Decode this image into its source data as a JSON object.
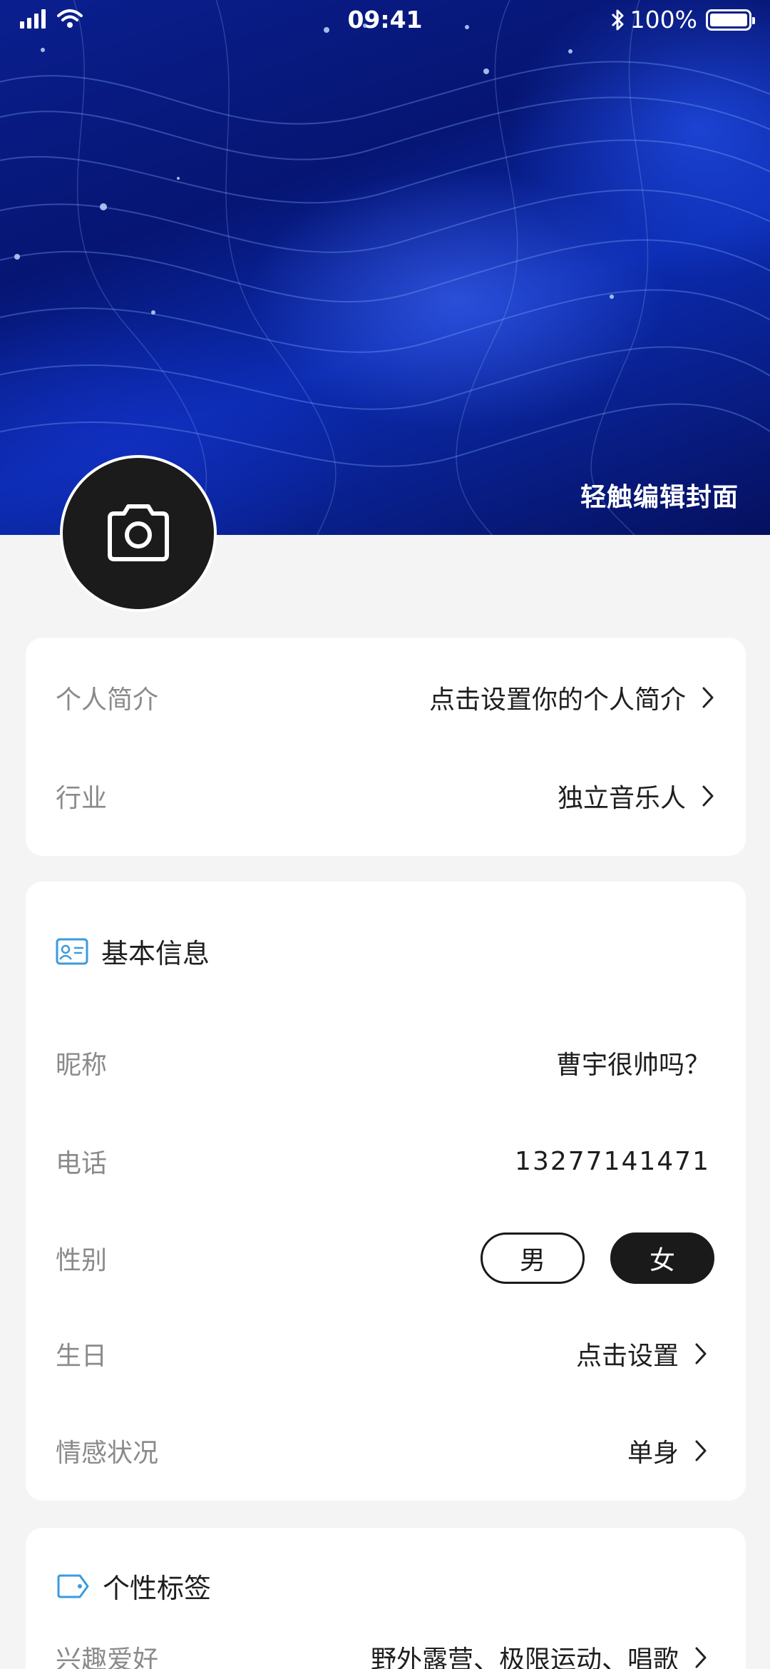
{
  "status_bar": {
    "time": "09:41",
    "battery": "100%"
  },
  "cover": {
    "edit_label": "轻触编辑封面"
  },
  "profile_card": {
    "rows": [
      {
        "label": "个人简介",
        "value": "点击设置你的个人简介"
      },
      {
        "label": "行业",
        "value": "独立音乐人"
      }
    ]
  },
  "basic_info": {
    "title": "基本信息",
    "nickname": {
      "label": "昵称",
      "value": "曹宇很帅吗？"
    },
    "phone": {
      "label": "电话",
      "value": "13277141471"
    },
    "gender": {
      "label": "性别",
      "options": [
        "男",
        "女"
      ],
      "selected": "女"
    },
    "birthday": {
      "label": "生日",
      "value": "点击设置"
    },
    "relationship": {
      "label": "情感状况",
      "value": "单身"
    }
  },
  "tags": {
    "title": "个性标签",
    "hobbies": {
      "label": "兴趣爱好",
      "value": "野外露营、极限运动、唱歌"
    }
  },
  "colors": {
    "accent": "#3a9be0",
    "dark": "#1a1a1a",
    "background": "#f4f4f4"
  }
}
